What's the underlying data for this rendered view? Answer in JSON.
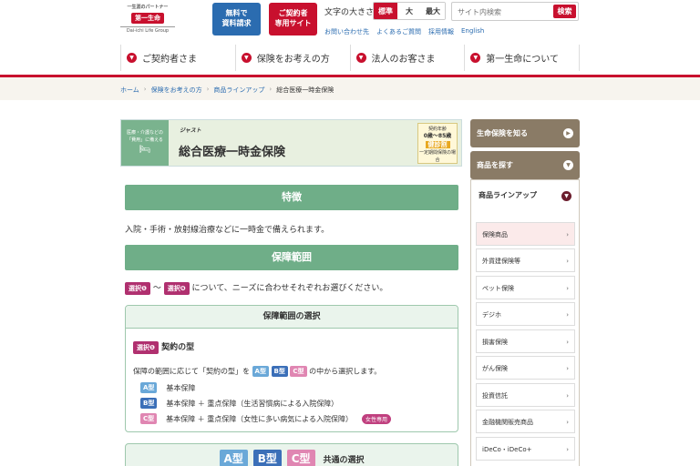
{
  "header": {
    "logo": {
      "tagline": "一生涯のパートナー",
      "brand": "第一生命",
      "group": "Dai-ichi Life Group"
    },
    "doc_request": "無料で\n資料請求",
    "member_site": "ご契約者\n専用サイト",
    "font_size": {
      "label": "文字の大きさ",
      "options": [
        "標準",
        "大",
        "最大"
      ],
      "selected": "標準"
    },
    "search": {
      "placeholder": "サイト内検索",
      "button": "検索"
    },
    "util_links": [
      "お問い合わせ先",
      "よくあるご質問",
      "採用情報",
      "English"
    ]
  },
  "gnav": [
    "ご契約者さま",
    "保険をお考えの方",
    "法人のお客さま",
    "第一生命について"
  ],
  "breadcrumb": [
    "ホーム",
    "保険をお考えの方",
    "商品ラインアップ",
    "総合医療一時金保険"
  ],
  "banner": {
    "left_text": "医療・介護などの\n「費用」に備える",
    "sub": "ジャスト",
    "title": "総合医療一時金保険",
    "age_label": "契約年齢",
    "age_range": "0歳～85歳",
    "stamp": "健診割",
    "stamp_note": "一定期間保険の場合"
  },
  "main": {
    "features_heading": "特徴",
    "features_text": "入院・手術・放射線治療などに一時金で備えられます。",
    "coverage_heading": "保障範囲",
    "select1": "選択❶",
    "select6": "選択❻",
    "tilde": "～",
    "coverage_text": "について、ニーズに合わせそれぞれお選びください。",
    "choice_box_head": "保障範囲の選択",
    "choice_title": "契約の型",
    "choice_desc_pre": "保障の範囲に応じて「契約の型」を",
    "choice_desc_post": "の中から選択します。",
    "tags": [
      "A型",
      "B型",
      "C型"
    ],
    "plans": [
      {
        "tag": "A型",
        "text": "基本保障"
      },
      {
        "tag": "B型",
        "text": "基本保障 ＋ 重点保障（生活習慣病による入院保障）"
      },
      {
        "tag": "C型",
        "text": "基本保障 ＋ 重点保障（女性に多い病気による入院保障）"
      }
    ],
    "female_badge": "女性専用",
    "common_label": "共通の選択"
  },
  "sidebar": {
    "know_life": "生命保険を知る",
    "find_product": "商品を探す",
    "lineup": "商品ラインアップ",
    "items": [
      "保険商品",
      "外貨建保険等",
      "ペット保険",
      "デジホ",
      "損害保険",
      "がん保険",
      "投資信託",
      "金融機関販売商品",
      "iDeCo・iDeCo+"
    ]
  }
}
